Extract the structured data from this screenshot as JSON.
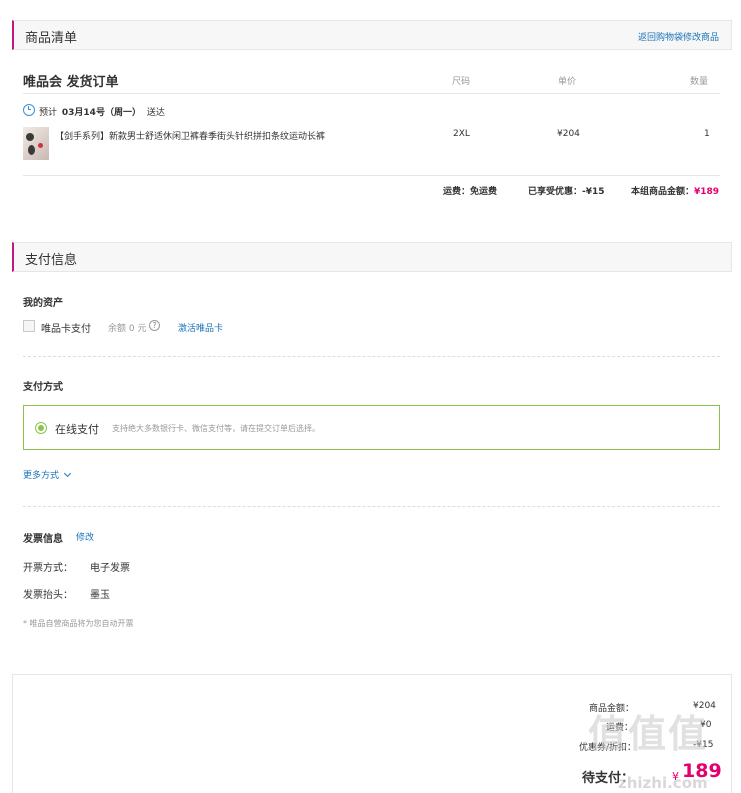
{
  "goods_section": {
    "title": "商品清单",
    "back_link": "返回购物袋修改商品"
  },
  "order": {
    "store_title": "唯品会 发货订单",
    "columns": {
      "size": "尺码",
      "unit_price": "单价",
      "quantity": "数量"
    },
    "delivery": {
      "prefix": "预计",
      "date": "03月14号（周一）",
      "suffix": "送达"
    },
    "items": [
      {
        "name": "【剑手系列】新款男士舒适休闲卫裤春季街头针织拼扣条纹运动长裤",
        "size": "2XL",
        "price": "¥204",
        "quantity": "1"
      }
    ],
    "totals": {
      "shipping_label": "运费：",
      "shipping_value": "免运费",
      "discount_label": "已享受优惠：",
      "discount_value": "-¥15",
      "amount_label": "本组商品金额：",
      "amount_value": "¥189"
    }
  },
  "payment_section": {
    "title": "支付信息",
    "assets": {
      "heading": "我的资产",
      "card_label": "唯品卡支付",
      "balance": "余额 0 元",
      "help_icon": "question-mark-icon",
      "activate_link": "激活唯品卡"
    },
    "methods": {
      "heading": "支付方式",
      "selected_label": "在线支付",
      "selected_desc": "支持绝大多数银行卡、微信支付等，请在提交订单后选择。",
      "more_link": "更多方式"
    },
    "invoice": {
      "heading": "发票信息",
      "edit_link": "修改",
      "type_label": "开票方式：",
      "type_value": "电子发票",
      "header_label": "发票抬头：",
      "header_value": "墨玉",
      "note": "* 唯品自营商品将为您自动开票"
    }
  },
  "summary": {
    "goods_amount_label": "商品金额：",
    "goods_amount_value": "¥204",
    "shipping_label": "运费：",
    "shipping_value": "¥0",
    "discount_label": "优惠券/折扣：",
    "discount_value": "-¥15",
    "due_label": "待支付：",
    "due_currency": "¥",
    "due_value": "189"
  },
  "watermark": {
    "mark": "值值值",
    "url": "zhizhi.com"
  },
  "colors": {
    "brand": "#c4177f",
    "price": "#e4006e",
    "link": "#1a73b8",
    "selected": "#8bc34a"
  }
}
